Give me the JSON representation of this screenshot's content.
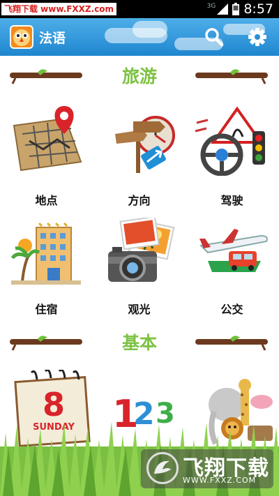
{
  "status_bar": {
    "watermark": "飞翔下载 www.FXXZ.com",
    "network": "3G",
    "time": "8:57"
  },
  "action_bar": {
    "title": "法语",
    "search_icon": "search-icon",
    "settings_icon": "gear-icon"
  },
  "sections": [
    {
      "title": "旅游",
      "items": [
        {
          "label": "地点",
          "icon": "map-pin-icon"
        },
        {
          "label": "方向",
          "icon": "signpost-icon"
        },
        {
          "label": "驾驶",
          "icon": "steering-wheel-icon"
        },
        {
          "label": "住宿",
          "icon": "hotel-icon"
        },
        {
          "label": "观光",
          "icon": "camera-icon"
        },
        {
          "label": "公交",
          "icon": "transport-icon"
        }
      ]
    },
    {
      "title": "基本",
      "items": [
        {
          "label": "",
          "icon": "calendar-icon",
          "calendar_day": "8",
          "calendar_weekday": "SUNDAY"
        },
        {
          "label": "",
          "icon": "numbers-icon",
          "numbers": "123"
        },
        {
          "label": "",
          "icon": "animals-icon"
        }
      ]
    }
  ],
  "watermark_logo": {
    "text": "飞翔下载",
    "url": "WWW.FXXZ.COM"
  }
}
